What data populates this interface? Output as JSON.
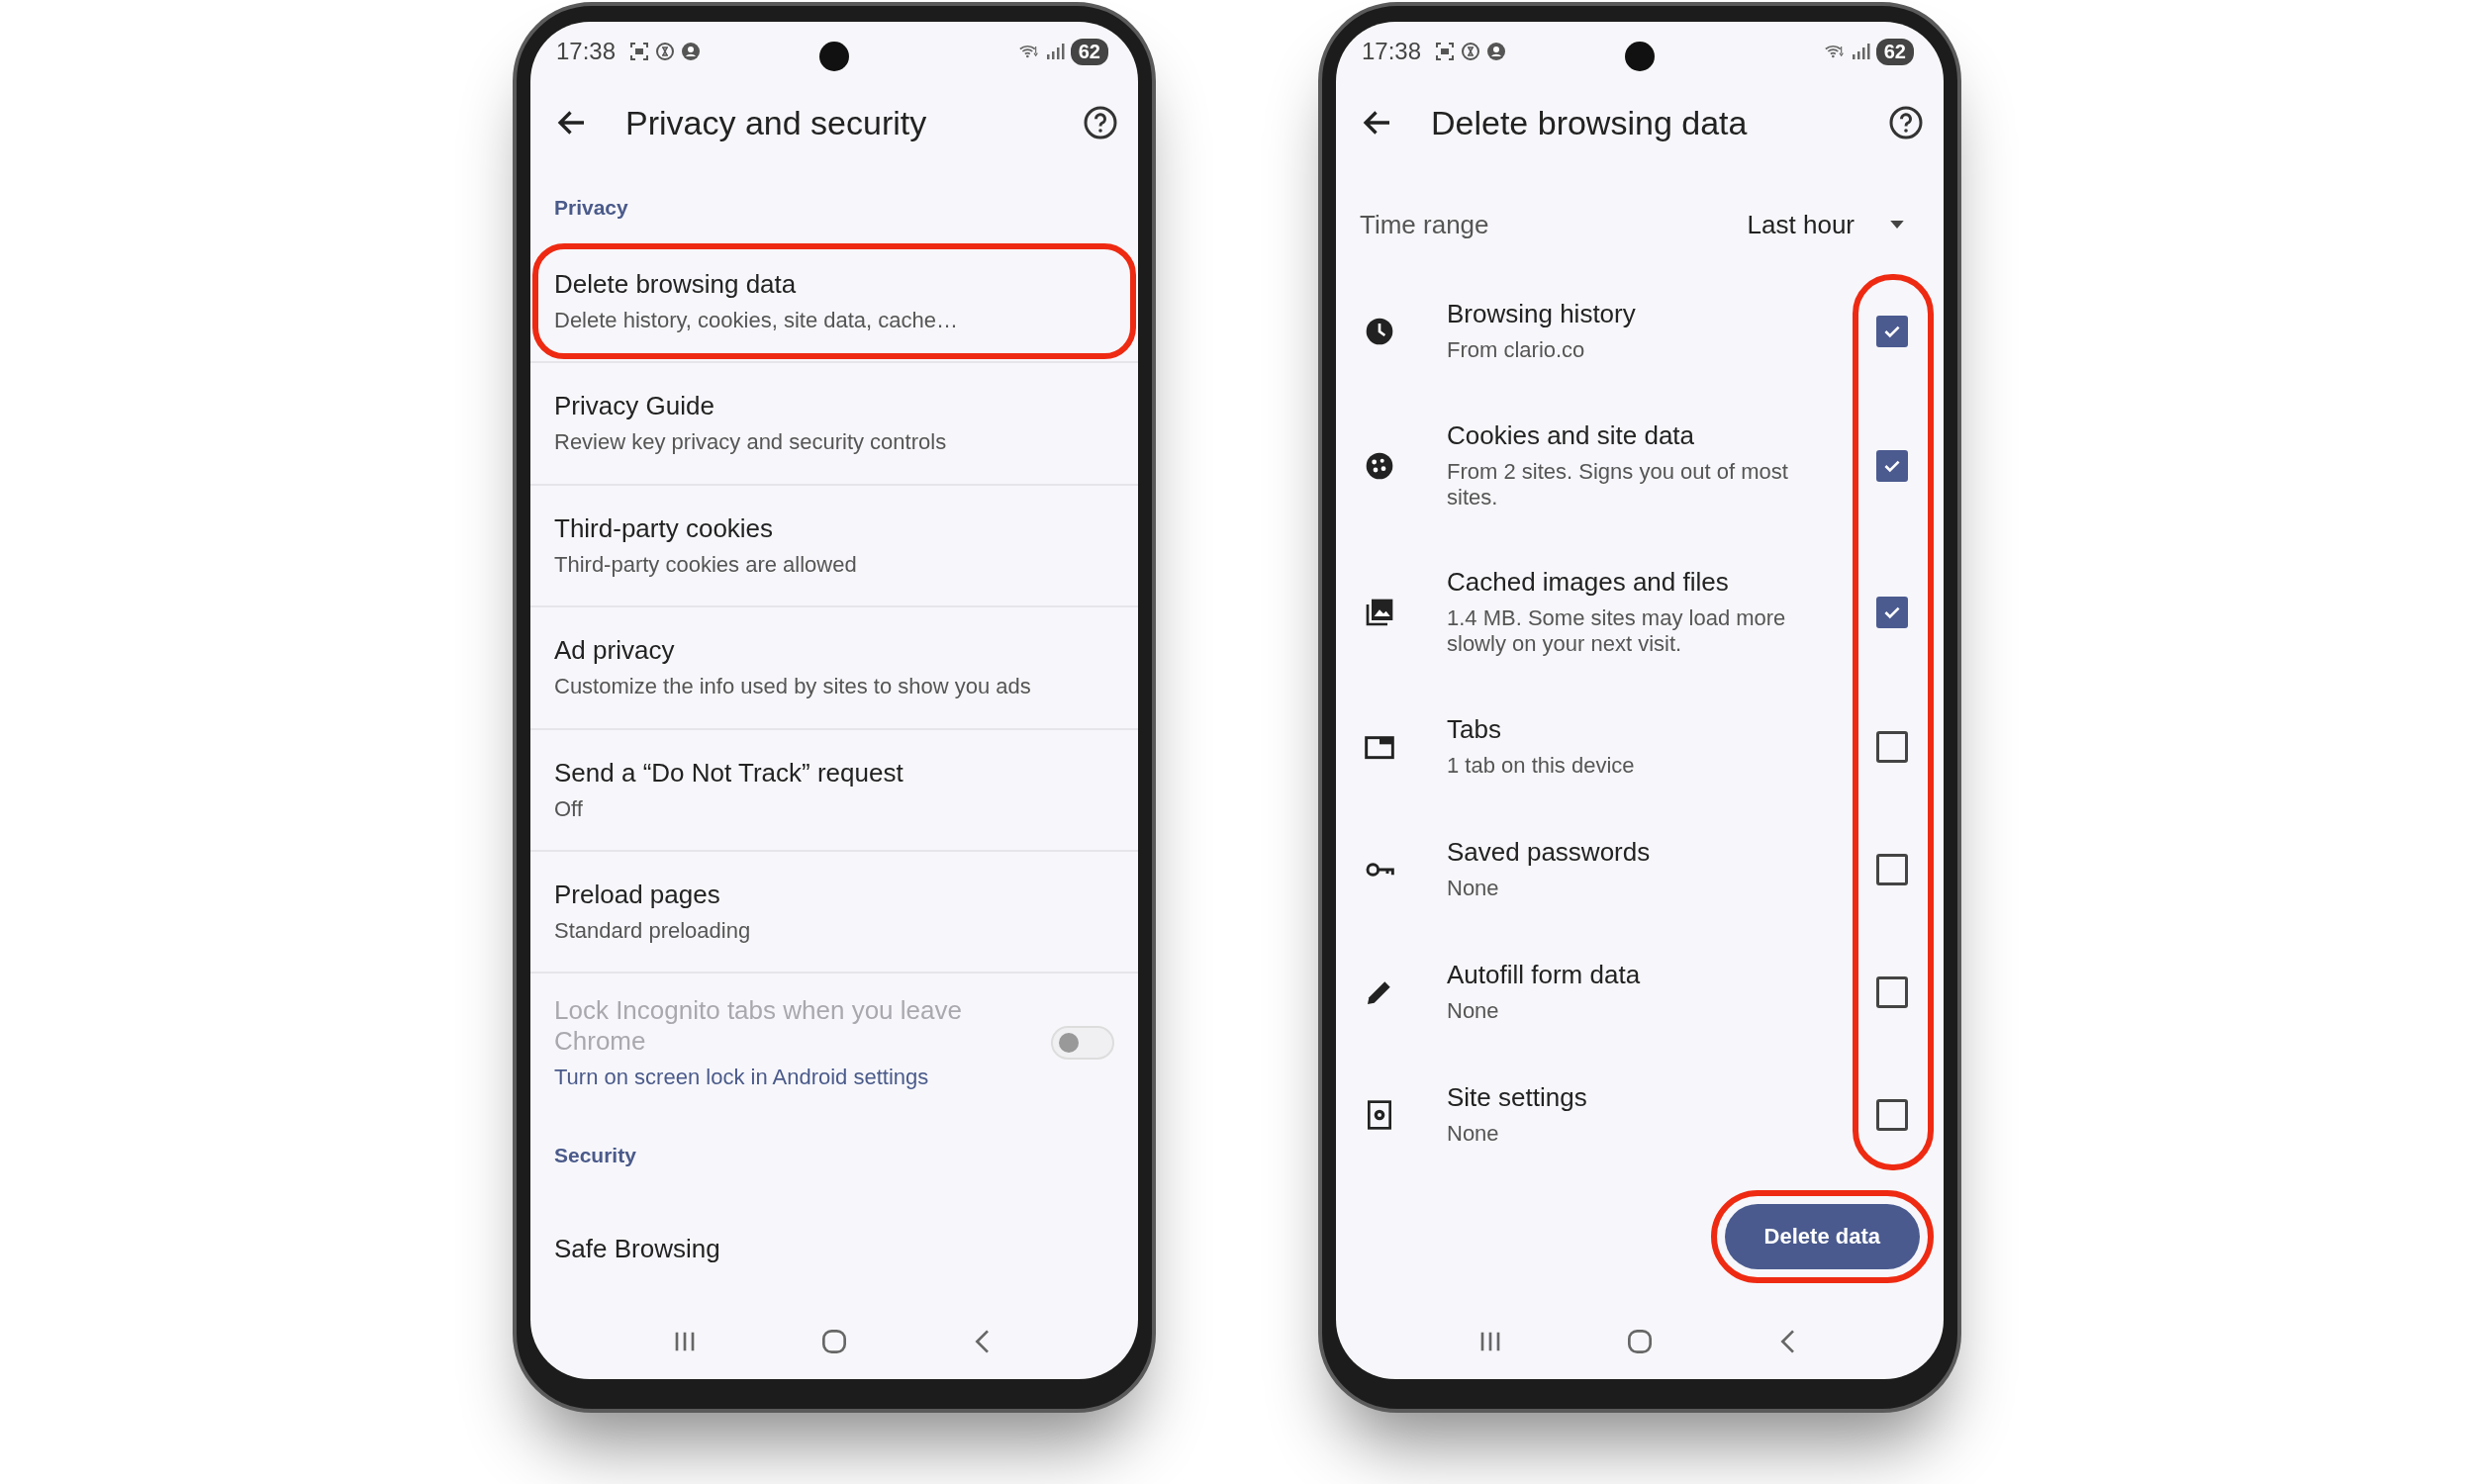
{
  "phones": [
    {
      "kind": "settings",
      "status": {
        "time": "17:38",
        "battery": "62"
      },
      "title": "Privacy and security",
      "items": [
        {
          "kind": "header",
          "title": "Privacy"
        },
        {
          "kind": "item",
          "title": "Delete browsing data",
          "subtitle": "Delete history, cookies, site data, cache…",
          "highlighted": true
        },
        {
          "kind": "item",
          "title": "Privacy Guide",
          "subtitle": "Review key privacy and security controls",
          "highlighted": false
        },
        {
          "kind": "item",
          "title": "Third-party cookies",
          "subtitle": "Third-party cookies are allowed",
          "highlighted": false
        },
        {
          "kind": "item",
          "title": "Ad privacy",
          "subtitle": "Customize the info used by sites to show you ads",
          "highlighted": false
        },
        {
          "kind": "item",
          "title": "Send a “Do Not Track” request",
          "subtitle": "Off",
          "highlighted": false
        },
        {
          "kind": "item",
          "title": "Preload pages",
          "subtitle": "Standard preloading",
          "highlighted": false
        },
        {
          "kind": "toggle",
          "title": "Lock Incognito tabs when you leave Chrome",
          "subtitle": "Turn on screen lock in Android settings",
          "disabled": true,
          "on": false
        },
        {
          "kind": "header",
          "title": "Security"
        },
        {
          "kind": "item",
          "title": "Safe Browsing",
          "highlighted": false
        }
      ]
    },
    {
      "kind": "delete",
      "status": {
        "time": "17:38",
        "battery": "62"
      },
      "title": "Delete browsing data",
      "time_range": {
        "label": "Time range",
        "value": "Last hour"
      },
      "checkboxes_highlighted": true,
      "items": [
        {
          "title": "Browsing history",
          "subtitle": "From clario.co",
          "checked": true
        },
        {
          "title": "Cookies and site data",
          "subtitle": "From 2 sites. Signs you out of most sites.",
          "checked": true
        },
        {
          "title": "Cached images and files",
          "subtitle": "1.4 MB. Some sites may load more slowly on your next visit.",
          "checked": true
        },
        {
          "title": "Tabs",
          "subtitle": "1 tab on this device",
          "checked": false
        },
        {
          "title": "Saved passwords",
          "subtitle": "None",
          "checked": false
        },
        {
          "title": "Autofill form data",
          "subtitle": "None",
          "checked": false
        },
        {
          "title": "Site settings",
          "subtitle": "None",
          "checked": false
        }
      ],
      "button": {
        "label": "Delete data",
        "highlighted": true
      }
    }
  ]
}
